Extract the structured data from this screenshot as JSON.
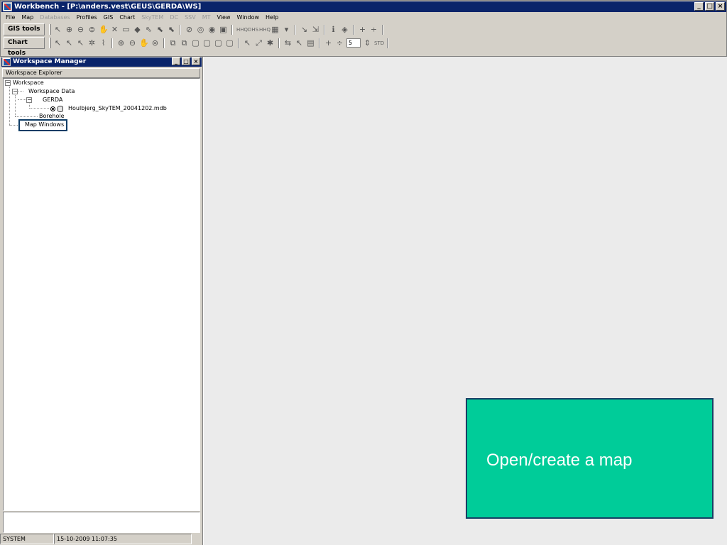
{
  "window": {
    "title": "Workbench - [P:\\anders.vest\\GEUS\\GERDA\\WS]",
    "controls": [
      "_",
      "□",
      "×"
    ]
  },
  "menubar": [
    {
      "label": "File",
      "enabled": true
    },
    {
      "label": "Map",
      "enabled": true
    },
    {
      "label": "Databases",
      "enabled": false
    },
    {
      "label": "Profiles",
      "enabled": true
    },
    {
      "label": "GIS",
      "enabled": true
    },
    {
      "label": "Chart",
      "enabled": true
    },
    {
      "label": "SkyTEM",
      "enabled": false
    },
    {
      "label": "DC",
      "enabled": false
    },
    {
      "label": "SSV",
      "enabled": false
    },
    {
      "label": "MT",
      "enabled": false
    },
    {
      "label": "View",
      "enabled": true
    },
    {
      "label": "Window",
      "enabled": true
    },
    {
      "label": "Help",
      "enabled": true
    }
  ],
  "toolbars": {
    "gis_label": "GIS tools",
    "chart_label": "Chart tools",
    "gis_text_buttons": [
      "HHQ",
      "DHS",
      "HHQ"
    ],
    "chart_spin_value": "5",
    "chart_std_label": "STD"
  },
  "workspace_manager": {
    "title": "Workspace Manager",
    "controls": [
      "_",
      "□",
      "×"
    ],
    "header": "Workspace Explorer",
    "tree": {
      "root": "Workspace",
      "data": "Workspace Data",
      "gerda": "GERDA",
      "file": "Houlbjerg_SkyTEM_20041202.mdb",
      "borehole": "Borehole",
      "map_windows": "Map Windows"
    }
  },
  "status": {
    "user": "SYSTEM",
    "datetime": "15-10-2009 11:07:35"
  },
  "callout": {
    "text": "Open/create a map",
    "color": "#00cc99",
    "border": "#173f64"
  }
}
